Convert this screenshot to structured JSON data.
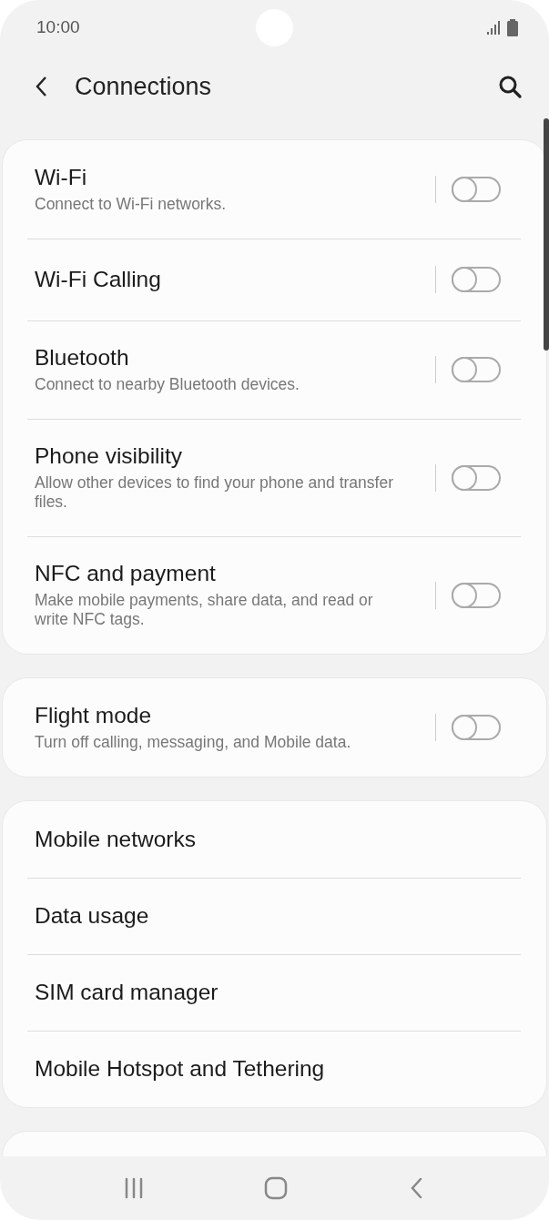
{
  "status_bar": {
    "time": "10:00"
  },
  "header": {
    "title": "Connections"
  },
  "groups": [
    {
      "items": [
        {
          "title": "Wi-Fi",
          "subtitle": "Connect to Wi-Fi networks.",
          "kind": "toggle",
          "on": false
        },
        {
          "title": "Wi-Fi Calling",
          "kind": "toggle",
          "on": false
        },
        {
          "title": "Bluetooth",
          "subtitle": "Connect to nearby Bluetooth devices.",
          "kind": "toggle",
          "on": false
        },
        {
          "title": "Phone visibility",
          "subtitle": "Allow other devices to find your phone and transfer files.",
          "kind": "toggle",
          "on": false
        },
        {
          "title": "NFC and payment",
          "subtitle": "Make mobile payments, share data, and read or write NFC tags.",
          "kind": "toggle",
          "on": false
        }
      ]
    },
    {
      "items": [
        {
          "title": "Flight mode",
          "subtitle": "Turn off calling, messaging, and Mobile data.",
          "kind": "toggle",
          "on": false
        }
      ]
    },
    {
      "items": [
        {
          "title": "Mobile networks",
          "kind": "link"
        },
        {
          "title": "Data usage",
          "kind": "link"
        },
        {
          "title": "SIM card manager",
          "kind": "link"
        },
        {
          "title": "Mobile Hotspot and Tethering",
          "kind": "link"
        }
      ]
    }
  ]
}
